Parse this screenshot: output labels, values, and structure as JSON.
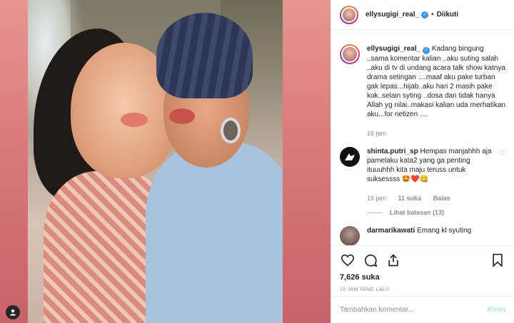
{
  "post": {
    "author": "ellysugigi_real_",
    "follow_state": "Diikuti",
    "dot": "•"
  },
  "caption": {
    "username": "ellysugigi_real_",
    "text": " Kadang bingung ..sama komentar kalian ..aku suting salah ..aku di tv di undang acara talk show katnya drama setingan ....maaf aku pake turban gak lepas...hijab..aku hari 2 masih pake kok..selain syting ..dosa dan tidak hanya Allah yg nilai..makasi kalian uda merhatikan aku...for netizen ....",
    "time": "16 jam"
  },
  "comments": [
    {
      "username": "shinta.putri_sp",
      "text": " Hempas manjahhh aja pamelaku kata2 yang ga penting ituuuhhh kita maju teruss untuk suksessss 🤩❤️😋",
      "time": "16 jam",
      "likes": "11 suka",
      "reply": "Balas",
      "view_replies": "Lihat balasan (13)"
    },
    {
      "username": "darmarikawati",
      "text": " Emang kl syuting"
    }
  ],
  "stats": {
    "likes": "7,626 suka",
    "time_ago": "16 JAM YANG LALU"
  },
  "add_comment": {
    "placeholder": "Tambahkan komentar...",
    "post_label": "Kirim"
  },
  "colors": {
    "link_blue": "#3897f0",
    "disabled_post": "#b2dffc",
    "muted": "#8e8e8e"
  }
}
